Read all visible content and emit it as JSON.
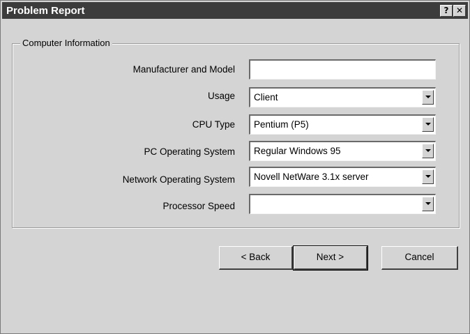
{
  "window": {
    "title": "Problem Report",
    "help_glyph": "?",
    "close_glyph": "✕"
  },
  "group": {
    "title": "Computer Information"
  },
  "fields": [
    {
      "label": "Manufacturer and Model",
      "value": "",
      "type": "text"
    },
    {
      "label": "Usage",
      "value": "Client",
      "type": "select"
    },
    {
      "label": "CPU Type",
      "value": "Pentium (P5)",
      "type": "select"
    },
    {
      "label": "PC Operating System",
      "value": "Regular Windows 95",
      "type": "select"
    },
    {
      "label": "Network Operating System",
      "value": "Novell NetWare 3.1x server",
      "type": "select"
    },
    {
      "label": "Processor Speed",
      "value": "",
      "type": "select"
    }
  ],
  "buttons": {
    "back": "< Back",
    "next": "Next >",
    "cancel": "Cancel"
  },
  "icons": {
    "dropdown": "chevron-down-icon",
    "help": "help-icon",
    "close": "close-icon"
  }
}
